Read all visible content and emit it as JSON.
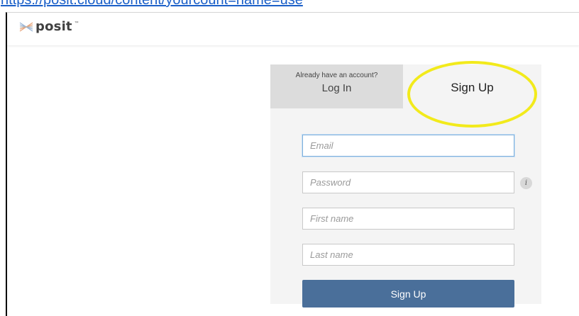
{
  "url_text": "https://posit.cloud/content/yourcount=name=use",
  "brand": {
    "name": "posit",
    "mark": "™"
  },
  "auth": {
    "login_tab": {
      "prompt": "Already have an account?",
      "label": "Log In"
    },
    "signup_tab": {
      "label": "Sign Up",
      "highlighted": true
    },
    "fields": {
      "email": {
        "placeholder": "Email",
        "value": "",
        "focused": true
      },
      "password": {
        "placeholder": "Password",
        "value": ""
      },
      "first_name": {
        "placeholder": "First name",
        "value": ""
      },
      "last_name": {
        "placeholder": "Last name",
        "value": ""
      }
    },
    "password_info_icon": "i",
    "submit_label": "Sign Up"
  },
  "colors": {
    "link": "#1a5fc8",
    "highlight": "#f2ea1b",
    "button": "#4a6f9a",
    "inactive_tab": "#dcdcdc",
    "panel": "#f4f4f4"
  }
}
